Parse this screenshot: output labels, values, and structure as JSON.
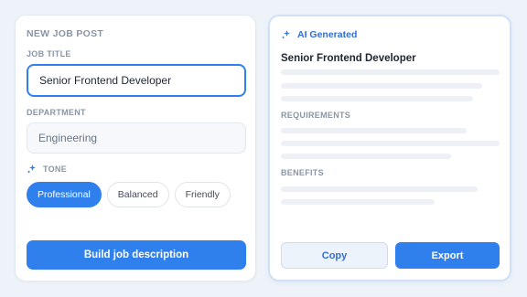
{
  "form": {
    "section_title": "NEW JOB POST",
    "job_title_label": "JOB TITLE",
    "job_title_value": "Senior Frontend Developer",
    "department_label": "DEPARTMENT",
    "department_placeholder": "Engineering",
    "tone_label": "TONE",
    "tones": [
      {
        "label": "Professional",
        "selected": true
      },
      {
        "label": "Balanced",
        "selected": false
      },
      {
        "label": "Friendly",
        "selected": false
      }
    ],
    "build_button": "Build job description"
  },
  "output": {
    "badge_label": "AI Generated",
    "generated_title": "Senior Frontend Developer",
    "requirements_heading": "REQUIREMENTS",
    "benefits_heading": "BENEFITS",
    "copy_button": "Copy",
    "export_button": "Export"
  },
  "colors": {
    "accent": "#2f80ed",
    "background": "#eef3f9"
  },
  "icons": {
    "tone": "sparkle-icon",
    "ai": "sparkle-icon"
  }
}
